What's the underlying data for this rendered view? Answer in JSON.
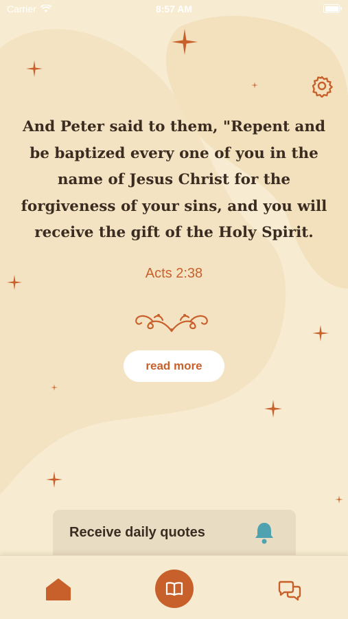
{
  "status_bar": {
    "carrier": "Carrier",
    "time": "8:57 AM",
    "wifi_icon": "wifi-icon",
    "battery_icon": "battery-icon"
  },
  "colors": {
    "background": "#f7ecd1",
    "accent": "#c8602b",
    "text": "#3a2c21",
    "bell": "#4fa2b0"
  },
  "header": {
    "settings_icon": "gear-icon"
  },
  "verse": {
    "text": "And Peter said to them, \"Repent and be baptized every one of you in the name of Jesus Christ for the forgiveness of your sins, and you will receive the gift of the Holy Spirit.",
    "reference": "Acts 2:38"
  },
  "actions": {
    "read_more_label": "read more"
  },
  "daily_quotes": {
    "label": "Receive daily quotes",
    "icon": "bell-icon"
  },
  "tab_bar": {
    "items": [
      {
        "icon": "home-icon"
      },
      {
        "icon": "book-icon",
        "selected": true
      },
      {
        "icon": "chat-icon"
      }
    ]
  }
}
